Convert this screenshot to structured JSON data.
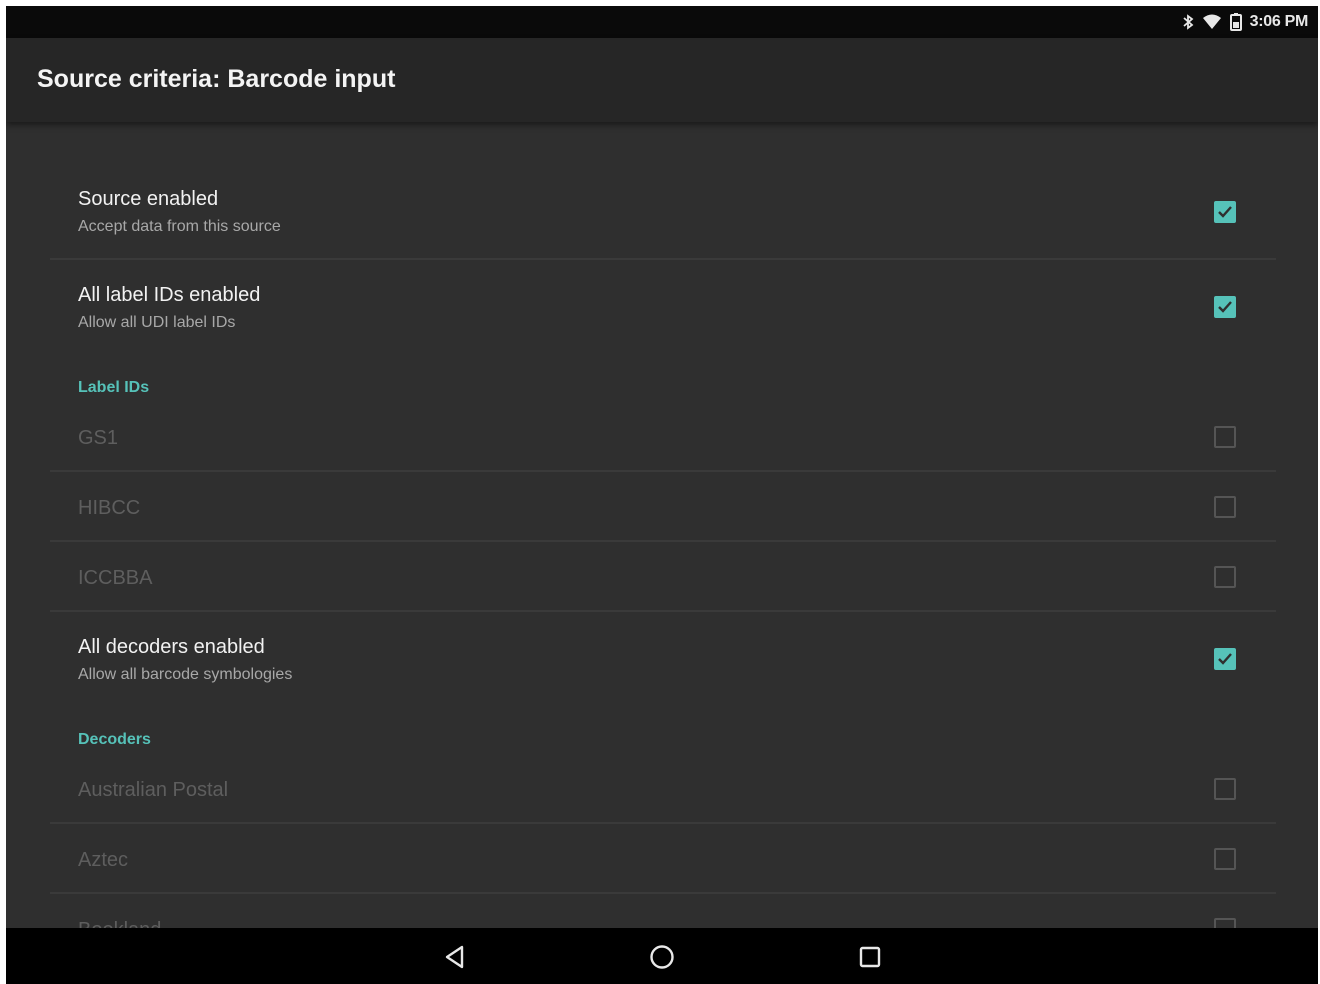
{
  "status_bar": {
    "time": "3:06 PM",
    "icons": [
      "bluetooth-icon",
      "wifi-icon",
      "battery-icon"
    ]
  },
  "app_bar": {
    "title": "Source criteria: Barcode input"
  },
  "preferences": [
    {
      "kind": "switch",
      "title": "Source enabled",
      "summary": "Accept data from this source",
      "checked": true,
      "enabled": true
    },
    {
      "kind": "switch",
      "title": "All label IDs enabled",
      "summary": "Allow all UDI label IDs",
      "checked": true,
      "enabled": true
    },
    {
      "kind": "category",
      "title": "Label IDs"
    },
    {
      "kind": "switch",
      "title": "GS1",
      "checked": false,
      "enabled": false
    },
    {
      "kind": "switch",
      "title": "HIBCC",
      "checked": false,
      "enabled": false
    },
    {
      "kind": "switch",
      "title": "ICCBBA",
      "checked": false,
      "enabled": false
    },
    {
      "kind": "switch",
      "title": "All decoders enabled",
      "summary": "Allow all barcode symbologies",
      "checked": true,
      "enabled": true
    },
    {
      "kind": "category",
      "title": "Decoders"
    },
    {
      "kind": "switch",
      "title": "Australian Postal",
      "checked": false,
      "enabled": false
    },
    {
      "kind": "switch",
      "title": "Aztec",
      "checked": false,
      "enabled": false
    },
    {
      "kind": "switch",
      "title": "Bookland",
      "checked": false,
      "enabled": false
    }
  ],
  "nav_bar": {
    "buttons": [
      "back-icon",
      "home-icon",
      "recents-icon"
    ]
  },
  "colors": {
    "accent": "#56c2b9",
    "background": "#2f2f2f",
    "app_bar": "#262626",
    "status_bar": "#0a0a0a",
    "nav_bar": "#000000"
  }
}
